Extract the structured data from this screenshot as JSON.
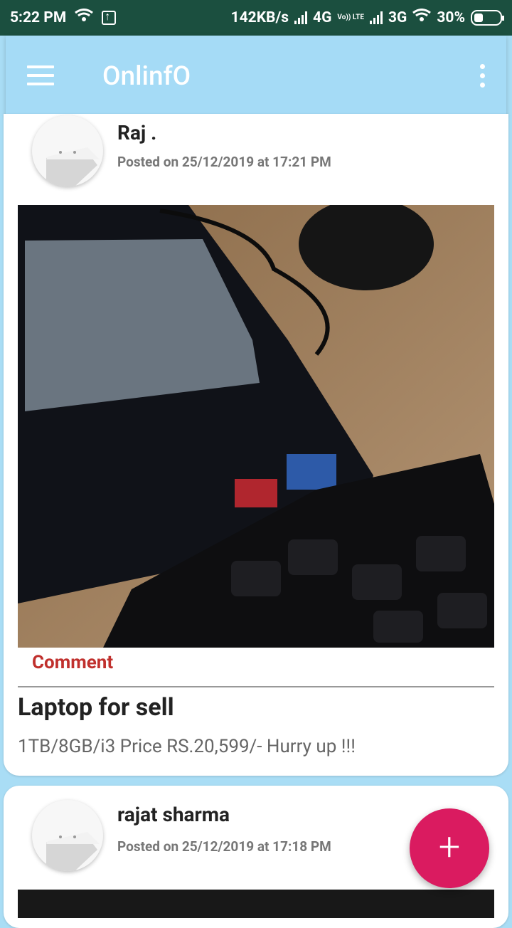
{
  "status_bar": {
    "time": "5:22 PM",
    "speed": "142KB/s",
    "net_4g": "4G",
    "volte": "Vo)) LTE",
    "net_3g": "3G",
    "battery": "30%"
  },
  "app_bar": {
    "title": "OnlinfO",
    "menu_icon": "hamburger-menu-icon",
    "overflow_icon": "more-vert-icon"
  },
  "posts": [
    {
      "author": "Raj .",
      "posted": "Posted on 25/12/2019 at 17:21 PM",
      "image": "laptop-photo",
      "comment_label": "Comment",
      "title": "Laptop for sell",
      "description": "1TB/8GB/i3 Price RS.20,599/- Hurry up !!!"
    },
    {
      "author": "rajat sharma",
      "posted": "Posted on 25/12/2019 at 17:18 PM",
      "image": "post-photo"
    }
  ],
  "fab": {
    "label": "+",
    "icon": "add-icon"
  },
  "colors": {
    "status_bar": "#1b4f3f",
    "app_bar": "#a5dbf6",
    "background": "#a9ddf5",
    "comment": "#c0302d",
    "fab": "#da1b60"
  }
}
